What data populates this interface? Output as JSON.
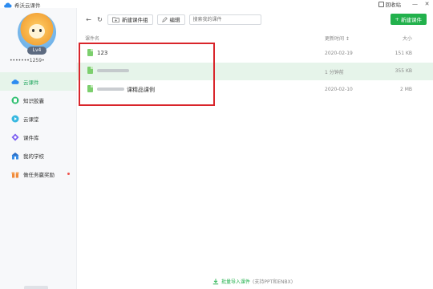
{
  "window": {
    "app_title": "希沃云课件",
    "recycle_label": "回收站",
    "minimize": "—",
    "close": "✕"
  },
  "user": {
    "level": "Lv4",
    "name": "•••••••1259•"
  },
  "sidebar": {
    "items": [
      {
        "label": "云课件",
        "icon": "cloud-icon",
        "active": true
      },
      {
        "label": "知识胶囊",
        "icon": "capsule-icon",
        "active": false
      },
      {
        "label": "云课堂",
        "icon": "classroom-icon",
        "active": false
      },
      {
        "label": "课件库",
        "icon": "library-icon",
        "active": false
      },
      {
        "label": "我的学校",
        "icon": "school-icon",
        "active": false
      },
      {
        "label": "做任务赢奖励",
        "icon": "gift-icon",
        "active": false,
        "badge": true
      }
    ]
  },
  "toolbar": {
    "back": "←",
    "refresh": "↻",
    "new_group_label": "新建课件组",
    "edit_label": "编辑",
    "search_placeholder": "搜索我的课件",
    "new_courseware_label": "新建课件"
  },
  "table": {
    "headers": {
      "name": "课件名",
      "updated": "更新时间 ↕",
      "size": "大小"
    },
    "rows": [
      {
        "name": "123",
        "updated": "2020-02-19",
        "size": "151 KB"
      },
      {
        "name": "",
        "updated": "1 分钟前",
        "size": "355 KB"
      },
      {
        "name": "课精品课例",
        "updated": "2020-02-10",
        "size": "2 MB"
      }
    ]
  },
  "footer": {
    "import_label": "批量导入课件",
    "import_hint": "(支持PPT和ENBX)"
  },
  "colors": {
    "accent": "#22b14c",
    "highlight": "#e6f4ea",
    "select_border": "#d9252b"
  }
}
